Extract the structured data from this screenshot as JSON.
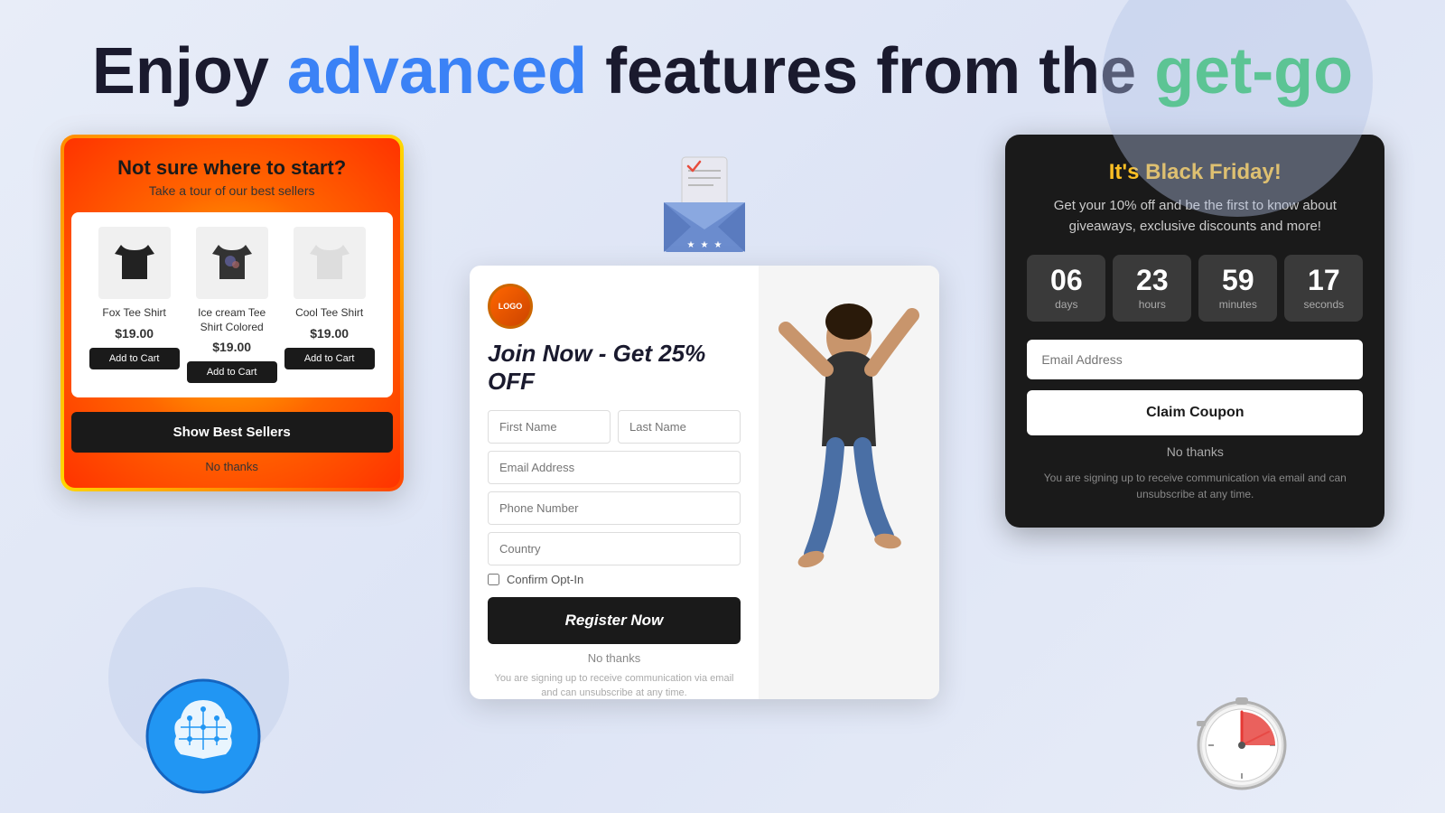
{
  "header": {
    "line1_part1": "Enjoy ",
    "line1_advanced": "advanced",
    "line1_part2": " features from the ",
    "line1_getgo": "get-go"
  },
  "bestseller_card": {
    "title": "Not sure where to start?",
    "subtitle": "Take a tour of our best sellers",
    "products": [
      {
        "name": "Fox Tee Shirt",
        "price": "$19.00",
        "add_label": "Add to Cart"
      },
      {
        "name": "Ice cream Tee Shirt Colored",
        "price": "$19.00",
        "add_label": "Add to Cart"
      },
      {
        "name": "Cool Tee Shirt",
        "price": "$19.00",
        "add_label": "Add to Cart"
      }
    ],
    "cta_label": "Show Best Sellers",
    "no_thanks": "No thanks"
  },
  "email_card": {
    "logo_text": "LOGO",
    "join_title": "Join Now - Get 25% OFF",
    "fields": {
      "first_name": "First Name",
      "last_name": "Last Name",
      "email": "Email Address",
      "phone": "Phone Number",
      "country": "Country"
    },
    "checkbox_label": "Confirm Opt-In",
    "cta_label": "Register Now",
    "no_thanks": "No thanks",
    "fine_print": "You are signing up to receive communication via email and can unsubscribe at any time."
  },
  "blackfriday_card": {
    "title": "It's Black Friday!",
    "subtitle": "Get your 10% off and be the first to know about giveaways, exclusive discounts and more!",
    "countdown": {
      "days_value": "06",
      "days_label": "days",
      "hours_value": "23",
      "hours_label": "hours",
      "minutes_value": "59",
      "minutes_label": "minutes",
      "seconds_value": "17",
      "seconds_label": "seconds"
    },
    "email_placeholder": "Email Address",
    "cta_label": "Claim Coupon",
    "no_thanks": "No thanks",
    "fine_print": "You are signing up to receive communication via email and can unsubscribe at any time."
  }
}
